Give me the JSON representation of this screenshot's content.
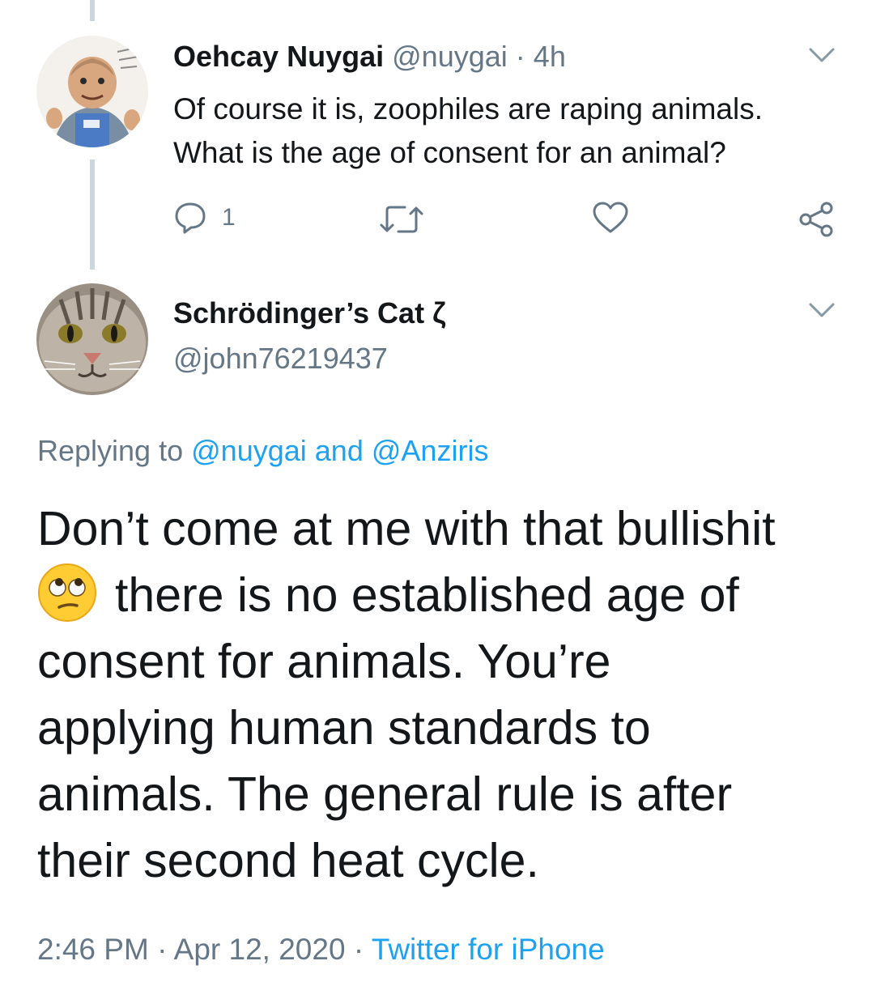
{
  "parent_tweet": {
    "display_name": "Oehcay Nuygai",
    "handle": "@nuygai",
    "separator": "·",
    "time": "4h",
    "text_lines": [
      "Of course it is, zoophiles are raping animals.",
      "What is the age of consent for an animal?"
    ],
    "reply_count": "1",
    "avatar": "cartoon-man-avatar"
  },
  "main_tweet": {
    "display_name": "Schrödinger’s Cat ζ",
    "handle": "@john76219437",
    "avatar": "cat-face-avatar",
    "replying_prefix": "Replying to",
    "replying_user1": "@nuygai",
    "replying_and": "and",
    "replying_user2": "@Anziris",
    "text_line1": "Don’t come at me with that bullishit",
    "emoji": "face-with-rolling-eyes",
    "text_line2_rest": "there is no established age of",
    "text_line3": "consent for animals. You’re",
    "text_line4": "applying human standards to",
    "text_line5": "animals. The general rule is after",
    "text_line6": "their second heat cycle.",
    "time": "2:46 PM",
    "separator": "·",
    "date": "Apr 12, 2020",
    "source": "Twitter for iPhone"
  },
  "colors": {
    "text": "#14171a",
    "muted": "#657786",
    "link": "#1da1f2",
    "thread_line": "#ccd6dd"
  }
}
